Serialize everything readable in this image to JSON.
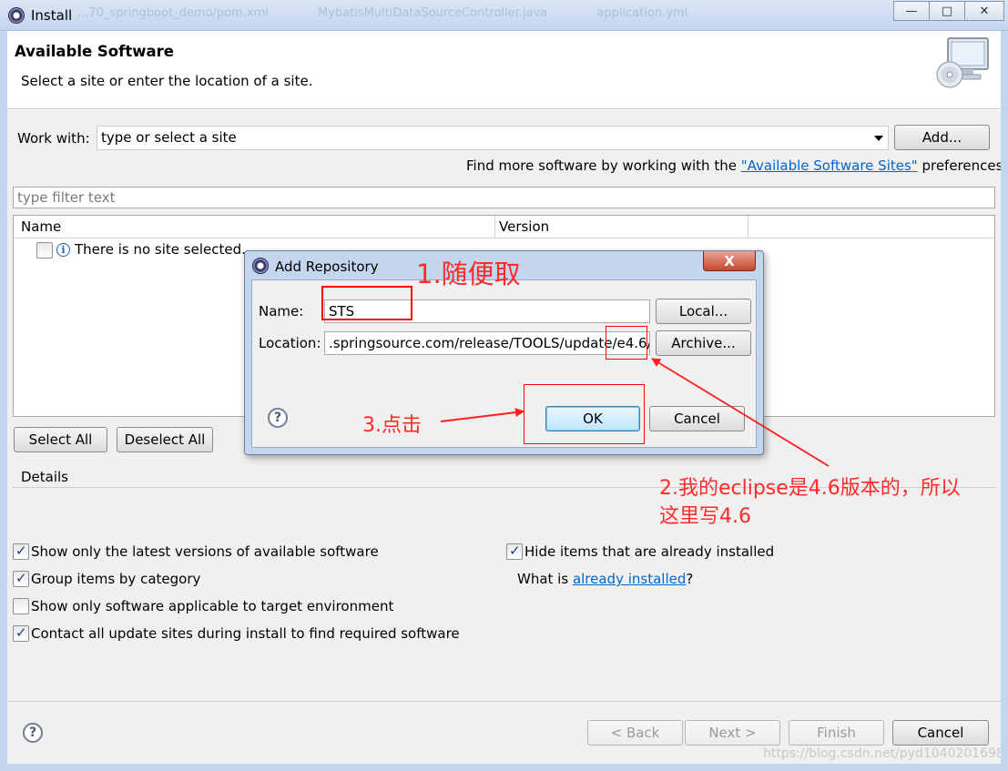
{
  "window": {
    "title": "Install",
    "background_tabs": [
      "...70_springboot_demo/pom.xml",
      "MybatisMultiDataSourceController.java",
      "application.yml"
    ],
    "controls": {
      "minimize": "—",
      "maximize": "□",
      "close": "✕"
    }
  },
  "header": {
    "title": "Available Software",
    "subtitle": "Select a site or enter the location of a site.",
    "image_icon": "software-cd-monitor-icon"
  },
  "work_with": {
    "label": "Work with:",
    "value": "type or select a site",
    "add_button": "Add...",
    "find_more_prefix": "Find more software by working with the ",
    "find_more_link": "\"Available Software Sites\"",
    "find_more_suffix": " preferences."
  },
  "filter": {
    "placeholder": "type filter text"
  },
  "table": {
    "columns": [
      "Name",
      "Version"
    ],
    "rows": [
      {
        "checked": false,
        "icon": "info-icon",
        "text": "There is no site selected."
      }
    ]
  },
  "selection_buttons": {
    "select_all": "Select All",
    "deselect_all": "Deselect All"
  },
  "details": {
    "label": "Details"
  },
  "options": {
    "left": [
      {
        "label": "Show only the latest versions of available software",
        "checked": true
      },
      {
        "label": "Group items by category",
        "checked": true
      },
      {
        "label": "Show only software applicable to target environment",
        "checked": false
      },
      {
        "label": "Contact all update sites during install to find required software",
        "checked": true
      }
    ],
    "right": [
      {
        "label": "Hide items that are already installed",
        "checked": true
      }
    ],
    "what_is_prefix": "What is ",
    "what_is_link": "already installed",
    "what_is_suffix": "?"
  },
  "footer": {
    "help_icon": "?",
    "back": "< Back",
    "next": "Next >",
    "finish": "Finish",
    "cancel": "Cancel",
    "watermark": "https://blog.csdn.net/pyd1040201698"
  },
  "dialog": {
    "title": "Add Repository",
    "close": "X",
    "name_label": "Name:",
    "name_value": "STS",
    "location_label": "Location:",
    "location_value": ".springsource.com/release/TOOLS/update/e4.6/",
    "local_button": "Local...",
    "archive_button": "Archive...",
    "ok_button": "OK",
    "cancel_button": "Cancel",
    "help_icon": "?"
  },
  "annotations": {
    "step1": "1.随便取",
    "step2_line1": "2.我的eclipse是4.6版本的，所以",
    "step2_line2": "这里写4.6",
    "step3": "3.点击",
    "color": "#ff0000"
  }
}
